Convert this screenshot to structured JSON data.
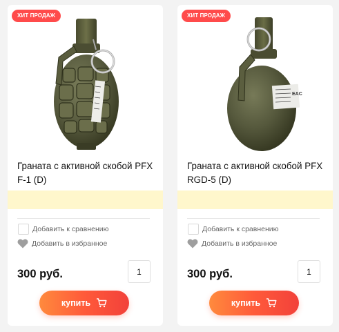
{
  "products": [
    {
      "badge": "ХИТ ПРОДАЖ",
      "title": "Граната с активной скобой PFX F-1 (D)",
      "compare_label": "Добавить к сравнению",
      "favorite_label": "Добавить в избранное",
      "price": "300 руб.",
      "quantity": "1",
      "buy_label": "купить",
      "image_icon": "f1-grenade-image"
    },
    {
      "badge": "ХИТ ПРОДАЖ",
      "title": "Граната с активной скобой PFX RGD-5 (D)",
      "compare_label": "Добавить к сравнению",
      "favorite_label": "Добавить в избранное",
      "price": "300 руб.",
      "quantity": "1",
      "buy_label": "купить",
      "image_icon": "rgd5-grenade-image"
    }
  ],
  "colors": {
    "badge": "#ff4b4b",
    "buy_gradient_start": "#ff8a3d",
    "buy_gradient_end": "#f2413a",
    "highlight_band": "#fff7cc",
    "grenade_body": "#575a3f"
  }
}
